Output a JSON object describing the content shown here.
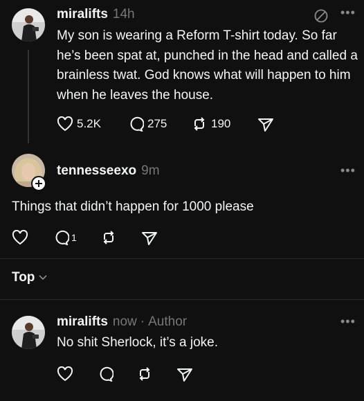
{
  "post": {
    "username": "miralifts",
    "time": "14h",
    "text": "My son is wearing a Reform T-shirt today. So far he’s been spat at, punched in the head and called a brainless twat. God knows what will happen to him when he leaves the house.",
    "likes": "5.2K",
    "replies": "275",
    "reposts": "190"
  },
  "reply": {
    "username": "tennesseexo",
    "time": "9m",
    "text": "Things that didn’t happen for 1000 please",
    "replies": "1"
  },
  "sort": {
    "label": "Top"
  },
  "author_reply": {
    "username": "miralifts",
    "time": "now",
    "separator": "·",
    "author_label": "Author",
    "text": "No shit Sherlock, it’s a joke."
  },
  "colors": {
    "background": "#101010",
    "text": "#f3f5f7",
    "muted": "#777777",
    "divider": "#2a2a2a"
  }
}
